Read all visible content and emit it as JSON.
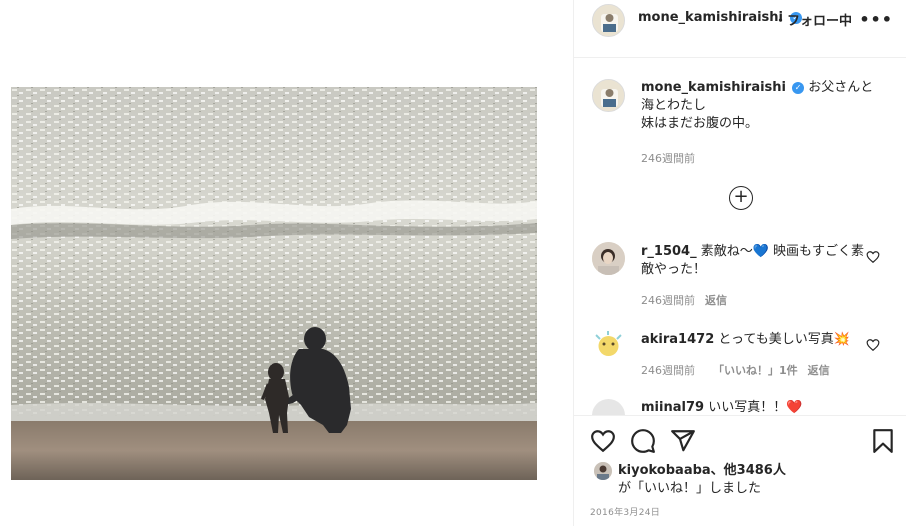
{
  "post": {
    "username": "mone_kamishiraishi",
    "follow_status": "・フォロー中",
    "more_label": "•••"
  },
  "caption": {
    "username": "mone_kamishiraishi",
    "text_line1": "お父さんと海とわたし",
    "text_line2": "妹はまだお腹の中。",
    "age": "246週間前"
  },
  "load_more_label": "+",
  "comments": [
    {
      "username": "r_1504_",
      "text": "素敵ね〜💙 映画もすごく素敵やった！",
      "age": "246週間前",
      "reply": "返信"
    },
    {
      "username": "akira1472",
      "text": "とっても美しい写真💥",
      "age": "246週間前",
      "likes": "「いいね！」1件",
      "reply": "返信"
    },
    {
      "username": "miinal79",
      "text": "いい写真！！❤️"
    }
  ],
  "likes": {
    "liker": "kiyokobaaba",
    "others": "、他3486人",
    "suffix": "が「いいね！」しました"
  },
  "date": "2016年3月24日",
  "colors": {
    "border": "#efefef",
    "meta_text": "#8e8e8e",
    "verified": "#3897f0",
    "primary_text": "#262626"
  },
  "icons": {
    "like": "heart-icon",
    "comment": "comment-bubble-icon",
    "share": "paper-plane-icon",
    "save": "bookmark-icon"
  }
}
